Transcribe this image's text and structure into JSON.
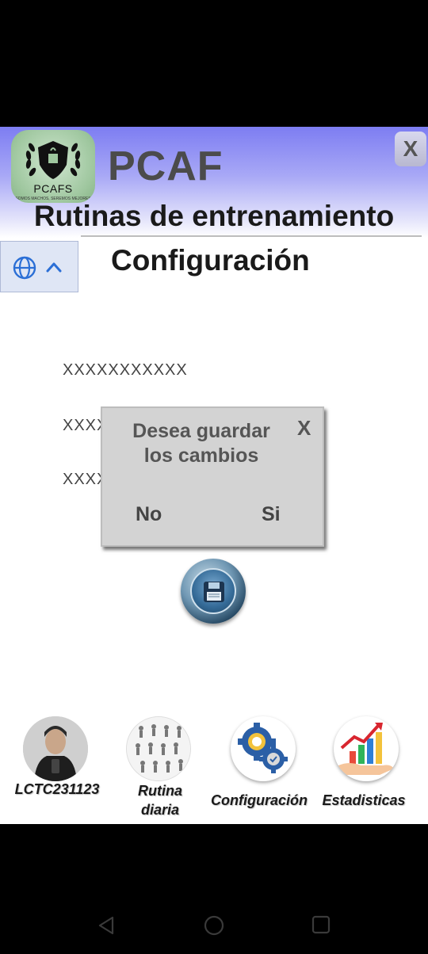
{
  "header": {
    "logo_text": "PCAFS",
    "logo_subtext": "SOMOS MACHOS, SEREMOS MEJORES",
    "app_title": "PCAF",
    "close_label": "X",
    "subtitle": "Rutinas de entrenamiento"
  },
  "language": {
    "icon": "globe-icon",
    "toggle_icon": "chevron-up-icon"
  },
  "main": {
    "section_title": "Configuración",
    "fields": [
      "XXXXXXXXXXX",
      "XXXX",
      "XXXX"
    ],
    "save_icon": "floppy-disk-icon"
  },
  "dialog": {
    "message": "Desea guardar los cambios",
    "close_label": "X",
    "no_label": "No",
    "yes_label": "Si"
  },
  "bottom_nav": {
    "items": [
      {
        "label": "LCTC231123",
        "icon": "user-avatar"
      },
      {
        "label": "Rutina diaria",
        "icon": "workout-grid-icon"
      },
      {
        "label": "Configuración",
        "icon": "gears-icon"
      },
      {
        "label": "Estadisticas",
        "icon": "growth-chart-icon"
      }
    ]
  },
  "colors": {
    "header_top": "#7d7df2",
    "dialog_bg": "#d3d3d3",
    "accent_blue": "#2b6fd6"
  }
}
